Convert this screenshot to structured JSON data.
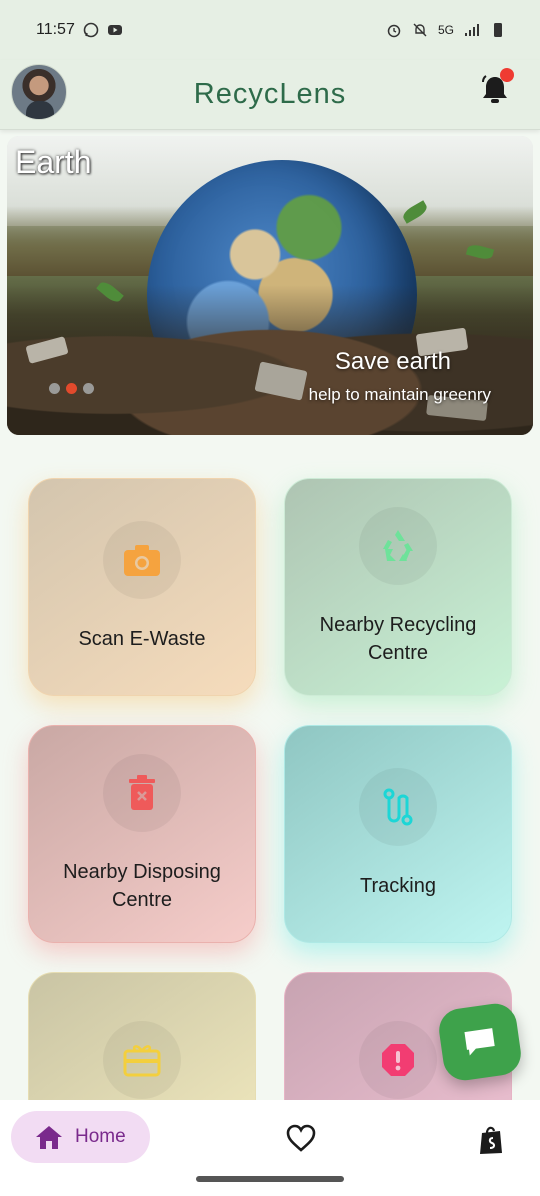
{
  "status_bar": {
    "time": "11:57",
    "network": "5G"
  },
  "app_bar": {
    "title": "RecycLens"
  },
  "banner": {
    "tag": "Earth",
    "title": "Save earth",
    "subtitle": "help to maintain greenry",
    "page_count": 3,
    "active_page": 2
  },
  "tiles": [
    {
      "label": "Scan E-Waste",
      "icon": "camera-icon",
      "color": "#f5a33f"
    },
    {
      "label": "Nearby Recycling Centre",
      "icon": "recycle-icon",
      "color": "#6ee29a"
    },
    {
      "label": "Nearby Disposing Centre",
      "icon": "trash-icon",
      "color": "#ef5a5a"
    },
    {
      "label": "Tracking",
      "icon": "route-icon",
      "color": "#1cd6d6"
    },
    {
      "label": "",
      "icon": "gift-card-icon",
      "color": "#f3cf3d"
    },
    {
      "label": "",
      "icon": "alert-icon",
      "color": "#f23d72"
    }
  ],
  "bottom_nav": {
    "home_label": "Home"
  },
  "colors": {
    "accent": "#2e6b4a",
    "notification_dot": "#ef3b32",
    "fab": "#3ea24b",
    "home_pill": "#f2dcf3"
  }
}
